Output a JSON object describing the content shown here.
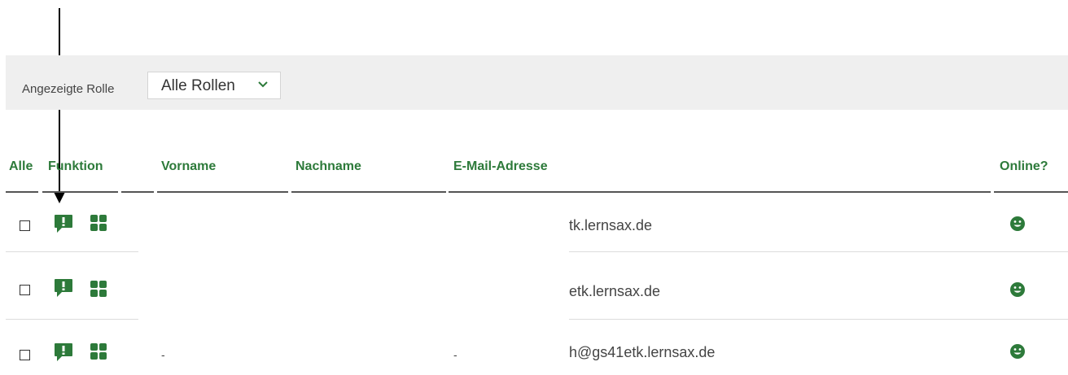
{
  "filter": {
    "label": "Angezeigte Rolle",
    "role_value": "Alle Rollen"
  },
  "table": {
    "headers": {
      "all": "Alle",
      "function": "Funktion",
      "firstname": "Vorname",
      "lastname": "Nachname",
      "email": "E-Mail-Adresse",
      "online": "Online?"
    },
    "rows": [
      {
        "email": "tk.lernsax.de",
        "firstname_fragment": "",
        "lastname_fragment": "",
        "checked": false,
        "online": true
      },
      {
        "email": "etk.lernsax.de",
        "firstname_fragment": "",
        "lastname_fragment": "",
        "checked": false,
        "online": true
      },
      {
        "email": "h@gs41etk.lernsax.de",
        "firstname_fragment": "-",
        "lastname_fragment": "-",
        "checked": false,
        "online": true
      }
    ]
  },
  "colors": {
    "accent_green": "#2d7a3a",
    "filter_bg": "#efefef",
    "annotation_arrow": "#000000"
  },
  "icons": {
    "function_message": "message-exclamation-icon",
    "function_apps": "apps-grid-icon",
    "online_status": "smiley-icon",
    "select_chevron": "chevron-down-icon"
  }
}
